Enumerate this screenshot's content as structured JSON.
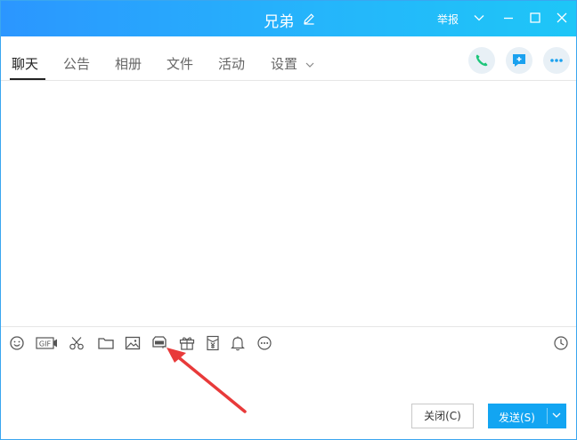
{
  "window": {
    "title": "兄弟",
    "report_label": "举报",
    "accent": "#2b96ff"
  },
  "tabs": [
    {
      "label": "聊天",
      "active": true
    },
    {
      "label": "公告"
    },
    {
      "label": "相册"
    },
    {
      "label": "文件"
    },
    {
      "label": "活动"
    },
    {
      "label": "设置"
    }
  ],
  "header_actions": [
    "phone-call-icon",
    "new-message-icon",
    "more-icon"
  ],
  "toolbar": {
    "gif_label": "GIF",
    "tools": [
      "emoji-icon",
      "gif-icon",
      "screenshot-scissors-icon",
      "folder-icon",
      "image-icon",
      "gift-icon",
      "red-envelope-icon",
      "bell-icon",
      "more-icon",
      "history-clock-icon"
    ]
  },
  "buttons": {
    "close_label": "关闭(C)",
    "send_label": "发送(S)",
    "send_color": "#12a5f2"
  },
  "annotation": {
    "arrow_color": "#e83a3a"
  }
}
